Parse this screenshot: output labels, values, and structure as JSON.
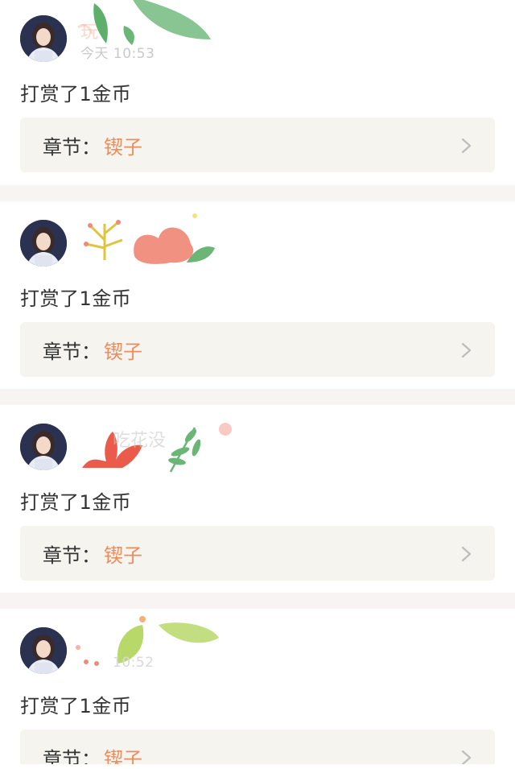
{
  "feed": {
    "items": [
      {
        "name": "玩",
        "time": "今天 10:53",
        "action": "打赏了1金币",
        "chapter_label": "章节：",
        "chapter_value": "锲子",
        "decoration": "leaf-green"
      },
      {
        "name": "",
        "time": "",
        "action": "打赏了1金币",
        "chapter_label": "章节：",
        "chapter_value": "锲子",
        "decoration": "flower-red"
      },
      {
        "name": "吃花没",
        "time": "",
        "action": "打赏了1金币",
        "chapter_label": "章节：",
        "chapter_value": "锲子",
        "decoration": "plant-red-green"
      },
      {
        "name": "",
        "time": "10:52",
        "action": "打赏了1金币",
        "chapter_label": "章节：",
        "chapter_value": "锲子",
        "decoration": "leaf-lime"
      }
    ]
  },
  "icons": {
    "chevron": "chevron-right-icon",
    "avatar": "avatar"
  },
  "colors": {
    "accent": "#ec8d5c",
    "text": "#333333",
    "chapter_bg": "#f5f4ef",
    "divider": "#f7f4f3"
  }
}
